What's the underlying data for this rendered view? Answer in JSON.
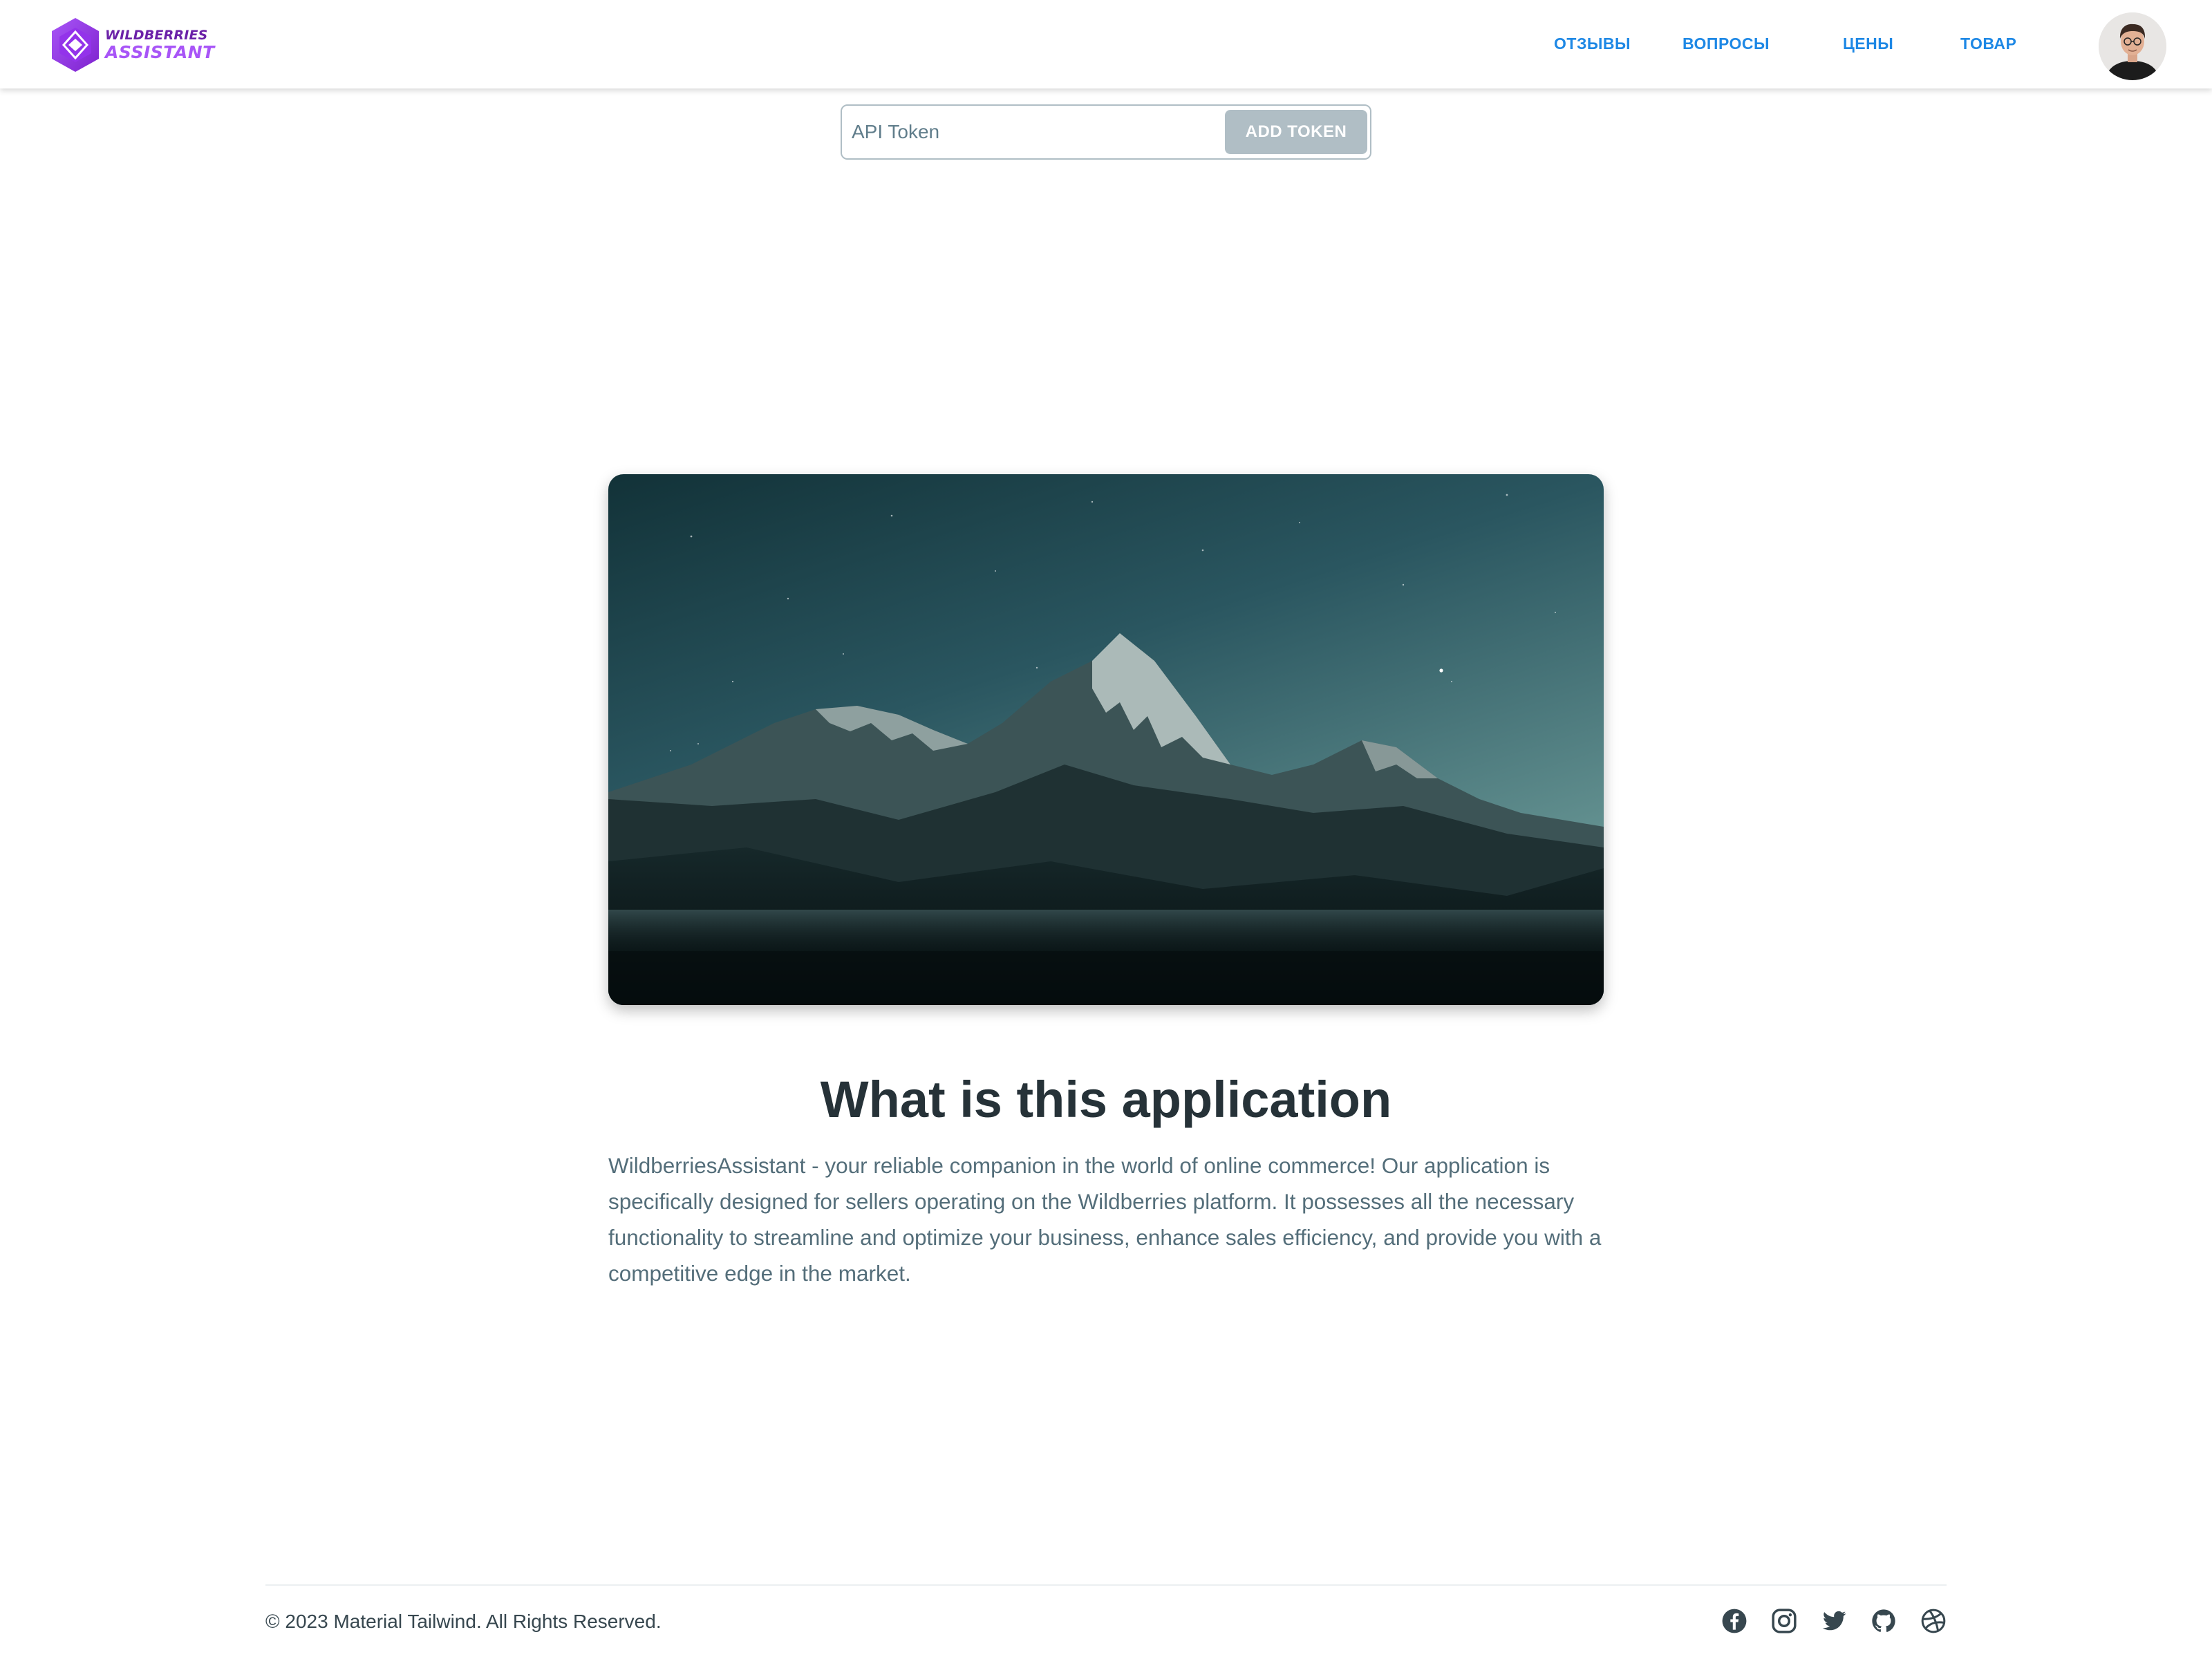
{
  "brand": {
    "line1": "WILDBERRIES",
    "line2": "ASSISTANT",
    "colors": {
      "dark": "#6b21a8",
      "light": "#a855f7"
    }
  },
  "nav": {
    "items": [
      {
        "label": "ОТЗЫВЫ"
      },
      {
        "label": "ВОПРОСЫ"
      },
      {
        "label": "ЦЕНЫ"
      },
      {
        "label": "ТОВАР"
      }
    ],
    "link_color": "#1e88e5"
  },
  "token": {
    "placeholder": "API Token",
    "value": "",
    "button_label": "ADD TOKEN"
  },
  "hero": {
    "image": "mountain-night-landscape"
  },
  "content": {
    "title": "What is this application",
    "description": "WildberriesAssistant - your reliable companion in the world of online commerce! Our application is specifically designed for sellers operating on the Wildberries platform. It possesses all the necessary functionality to streamline and optimize your business, enhance sales efficiency, and provide you with a competitive edge in the market."
  },
  "footer": {
    "copyright": "© 2023 Material Tailwind. All Rights Reserved.",
    "socials": [
      {
        "icon": "facebook-icon"
      },
      {
        "icon": "instagram-icon"
      },
      {
        "icon": "twitter-icon"
      },
      {
        "icon": "github-icon"
      },
      {
        "icon": "dribbble-icon"
      }
    ]
  }
}
